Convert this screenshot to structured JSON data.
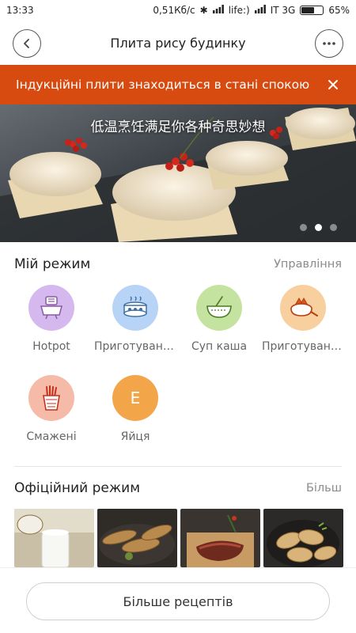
{
  "status_bar": {
    "time": "13:33",
    "speed": "0,51Кб/с",
    "carrier": "life:)",
    "network": "IT 3G",
    "battery": "65%",
    "battery_level": 0.65
  },
  "header": {
    "title": "Плита рису будинку",
    "back_icon": "back-arrow-icon",
    "more_icon": "more-dots-icon"
  },
  "alert": {
    "text": "Індукційні плити знаходиться в стані спокою"
  },
  "banner": {
    "subtitle": "低温烹饪满足你各种奇思妙想",
    "slide_count": 3,
    "active_slide": 2
  },
  "my_mode": {
    "title": "Мій режим",
    "manage_link": "Управління",
    "items": [
      {
        "label": "Hotpot",
        "icon": "hotpot-icon",
        "color": "#c8a7e6"
      },
      {
        "label": "Приготування на пару",
        "icon": "steamer-icon",
        "color": "#a9c8f2"
      },
      {
        "label": "Суп каша",
        "icon": "soup-bowl-icon",
        "color": "#b9dc8e"
      },
      {
        "label": "Приготування на грилі",
        "icon": "grill-icon",
        "color": "#f6c48a"
      },
      {
        "label": "Смажені",
        "icon": "fries-icon",
        "color": "#f4b19c"
      },
      {
        "label": "Яйця",
        "icon": "letter-e-icon",
        "color": "#f3a54a",
        "letter": "E"
      }
    ]
  },
  "official_mode": {
    "title": "Офіційний режим",
    "more_link": "Більш"
  },
  "footer": {
    "more_recipes_label": "Більше рецептів"
  }
}
